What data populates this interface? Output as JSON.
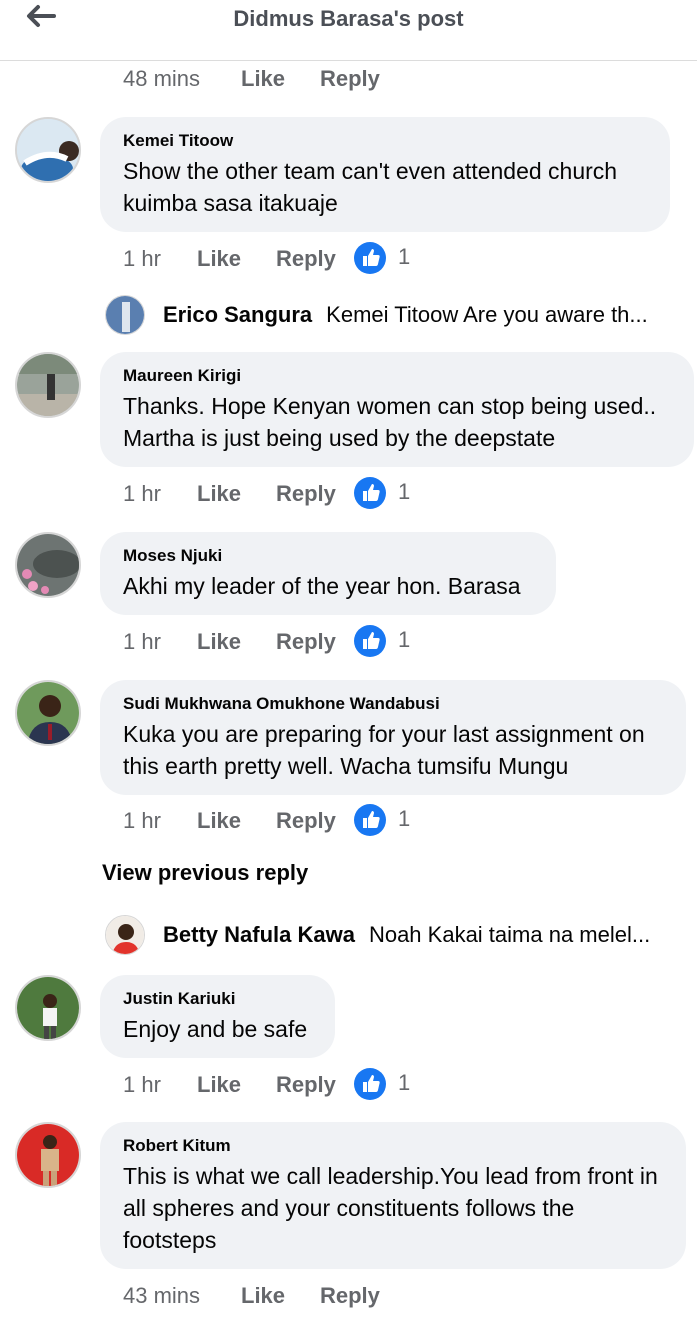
{
  "header": {
    "title": "Didmus Barasa's post"
  },
  "top_actions": {
    "time": "48 mins",
    "like": "Like",
    "reply": "Reply"
  },
  "comments": [
    {
      "author": "Kemei Titoow",
      "text": "Show the other team can't even attended  church kuimba sasa itakuaje",
      "time": "1 hr",
      "like": "Like",
      "reply": "Reply",
      "reactions": "1"
    },
    {
      "author": "Maureen Kirigi",
      "text": "Thanks. Hope Kenyan women can stop being used.. Martha is just being used by the deepstate",
      "time": "1 hr",
      "like": "Like",
      "reply": "Reply",
      "reactions": "1"
    },
    {
      "author": "Moses Njuki",
      "text": "Akhi my leader of the year hon. Barasa",
      "time": "1 hr",
      "like": "Like",
      "reply": "Reply",
      "reactions": "1"
    },
    {
      "author": "Sudi Mukhwana Omukhone Wandabusi",
      "text": "Kuka you are preparing for your last assignment on this earth pretty well. Wacha tumsifu Mungu",
      "time": "1 hr",
      "like": "Like",
      "reply": "Reply",
      "reactions": "1"
    },
    {
      "author": "Justin Kariuki",
      "text": "Enjoy and be safe",
      "time": "1 hr",
      "like": "Like",
      "reply": "Reply",
      "reactions": "1"
    },
    {
      "author": "Robert Kitum",
      "text": "This is what we call leadership.You lead from front in all spheres and your constituents follows the footsteps",
      "time": "43 mins",
      "like": "Like",
      "reply": "Reply"
    }
  ],
  "replies": [
    {
      "author": "Erico Sangura",
      "text": "Kemei Titoow Are you aware th..."
    },
    {
      "author": "Betty Nafula Kawa",
      "text": "Noah Kakai taima na melel..."
    }
  ],
  "view_previous": "View previous reply",
  "colors": {
    "accent": "#1877f2",
    "bubble": "#f0f2f5",
    "muted": "#65676b"
  }
}
